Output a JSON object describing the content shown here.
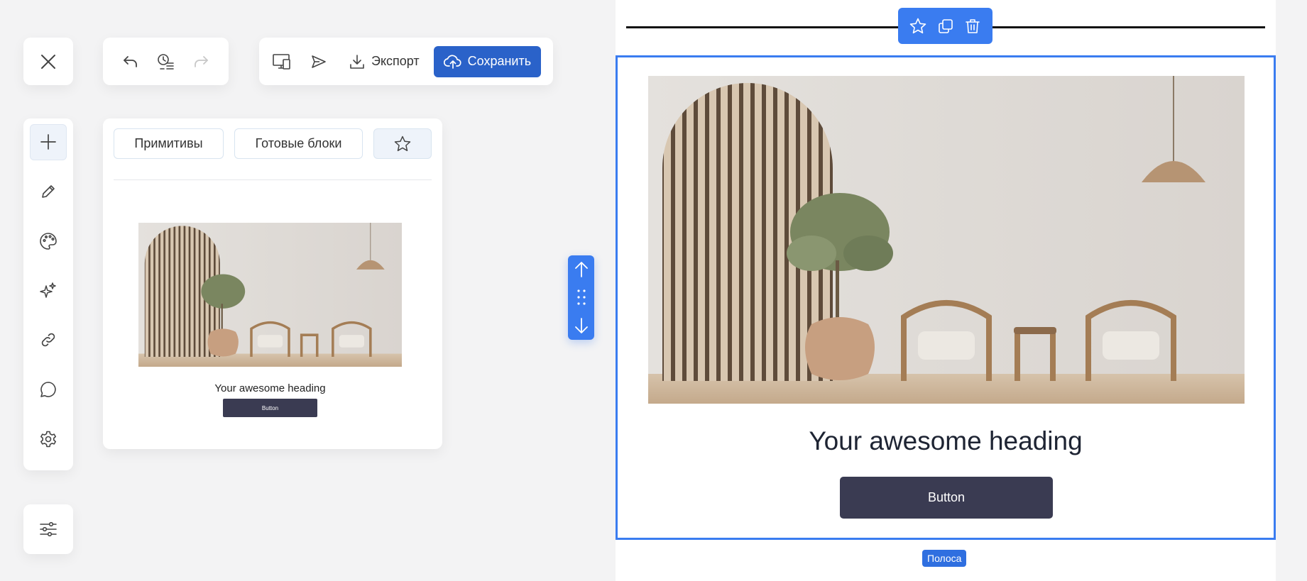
{
  "toolbar": {
    "export_label": "Экспорт",
    "save_label": "Сохранить"
  },
  "blocks_panel": {
    "tabs": [
      {
        "label": "Примитивы"
      },
      {
        "label": "Готовые блоки"
      }
    ],
    "thumbnail": {
      "heading": "Your awesome heading",
      "button": "Button"
    }
  },
  "canvas": {
    "heading": "Your awesome heading",
    "button": "Button",
    "row_label": "Полоса"
  },
  "colors": {
    "accent": "#3a7cf0",
    "save_button": "#2a62c9",
    "button_dark": "#3a3b52",
    "background": "#f3f3f4"
  },
  "icons": {
    "close": "close-icon",
    "undo": "undo-icon",
    "history": "history-icon",
    "redo": "redo-icon",
    "preview": "preview-devices-icon",
    "send": "send-icon",
    "export": "download-icon",
    "save": "cloud-upload-icon",
    "add": "plus-icon",
    "edit": "pencil-icon",
    "palette": "palette-icon",
    "ai": "sparkles-icon",
    "link": "link-icon",
    "comment": "comment-icon",
    "settings": "gear-icon",
    "settings_sliders": "sliders-icon",
    "favorite": "star-icon",
    "duplicate": "duplicate-icon",
    "delete": "trash-icon",
    "move_up": "arrow-up-icon",
    "drag": "drag-handle-icon",
    "move_down": "arrow-down-icon"
  }
}
